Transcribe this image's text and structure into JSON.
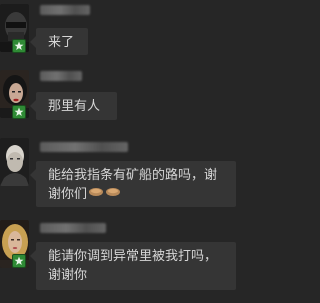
{
  "messages": [
    {
      "text": "来了",
      "avatar": "avatar-masked-face",
      "sender_name_blurred": true
    },
    {
      "text": "那里有人",
      "avatar": "avatar-female-red-lips",
      "sender_name_blurred": true
    },
    {
      "text": "能给我指条有矿船的路吗，谢谢你们",
      "emoji": "folded-hands-icon",
      "avatar": "avatar-bald-male",
      "sender_name_blurred": true
    },
    {
      "text": "能请你调到异常里被我打吗，谢谢你",
      "avatar": "avatar-blonde-female",
      "sender_name_blurred": true
    }
  ],
  "colors": {
    "background": "#262626",
    "bubble": "#353535",
    "text": "#d6d6d6",
    "badge": "#2f8a35"
  }
}
